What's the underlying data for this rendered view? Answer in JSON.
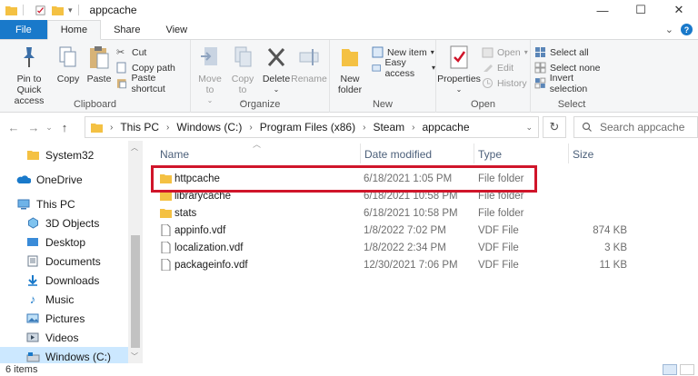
{
  "window": {
    "title": "appcache",
    "controls": {
      "minimize": "—",
      "maximize": "☐",
      "close": "✕"
    }
  },
  "ribbon_tabs": [
    "File",
    "Home",
    "Share",
    "View"
  ],
  "ribbon": {
    "clipboard": {
      "label": "Clipboard",
      "pin": "Pin to Quick access",
      "copy": "Copy",
      "paste": "Paste",
      "cut": "Cut",
      "copy_path": "Copy path",
      "paste_shortcut": "Paste shortcut"
    },
    "organize": {
      "label": "Organize",
      "move_to": "Move to",
      "copy_to": "Copy to",
      "delete": "Delete",
      "rename": "Rename"
    },
    "new": {
      "label": "New",
      "new_folder": "New folder",
      "new_item": "New item",
      "easy_access": "Easy access"
    },
    "open": {
      "label": "Open",
      "properties": "Properties",
      "open": "Open",
      "edit": "Edit",
      "history": "History"
    },
    "select": {
      "label": "Select",
      "select_all": "Select all",
      "select_none": "Select none",
      "invert": "Invert selection"
    }
  },
  "address": {
    "crumbs": [
      "This PC",
      "Windows (C:)",
      "Program Files (x86)",
      "Steam",
      "appcache"
    ],
    "search_placeholder": "Search appcache"
  },
  "nav": {
    "items": [
      {
        "label": "System32",
        "icon": "folder-icon"
      },
      {
        "label": "OneDrive",
        "icon": "cloud-icon"
      },
      {
        "label": "This PC",
        "icon": "pc-icon"
      },
      {
        "label": "3D Objects",
        "icon": "cube-icon"
      },
      {
        "label": "Desktop",
        "icon": "desktop-icon"
      },
      {
        "label": "Documents",
        "icon": "documents-icon"
      },
      {
        "label": "Downloads",
        "icon": "download-icon"
      },
      {
        "label": "Music",
        "icon": "music-icon"
      },
      {
        "label": "Pictures",
        "icon": "pictures-icon"
      },
      {
        "label": "Videos",
        "icon": "videos-icon"
      },
      {
        "label": "Windows (C:)",
        "icon": "drive-icon"
      }
    ]
  },
  "columns": {
    "name": "Name",
    "date": "Date modified",
    "type": "Type",
    "size": "Size"
  },
  "files": [
    {
      "name": "httpcache",
      "date": "6/18/2021 1:05 PM",
      "type": "File folder",
      "size": "",
      "kind": "folder"
    },
    {
      "name": "librarycache",
      "date": "6/18/2021 10:58 PM",
      "type": "File folder",
      "size": "",
      "kind": "folder"
    },
    {
      "name": "stats",
      "date": "6/18/2021 10:58 PM",
      "type": "File folder",
      "size": "",
      "kind": "folder"
    },
    {
      "name": "appinfo.vdf",
      "date": "1/8/2022 7:02 PM",
      "type": "VDF File",
      "size": "874 KB",
      "kind": "file"
    },
    {
      "name": "localization.vdf",
      "date": "1/8/2022 2:34 PM",
      "type": "VDF File",
      "size": "3 KB",
      "kind": "file"
    },
    {
      "name": "packageinfo.vdf",
      "date": "12/30/2021 7:06 PM",
      "type": "VDF File",
      "size": "11 KB",
      "kind": "file"
    }
  ],
  "status": {
    "count": "6 items"
  },
  "colors": {
    "accent": "#1979ca",
    "folder": "#f4c143",
    "highlight": "#d0152a",
    "selected": "#cce8ff"
  }
}
